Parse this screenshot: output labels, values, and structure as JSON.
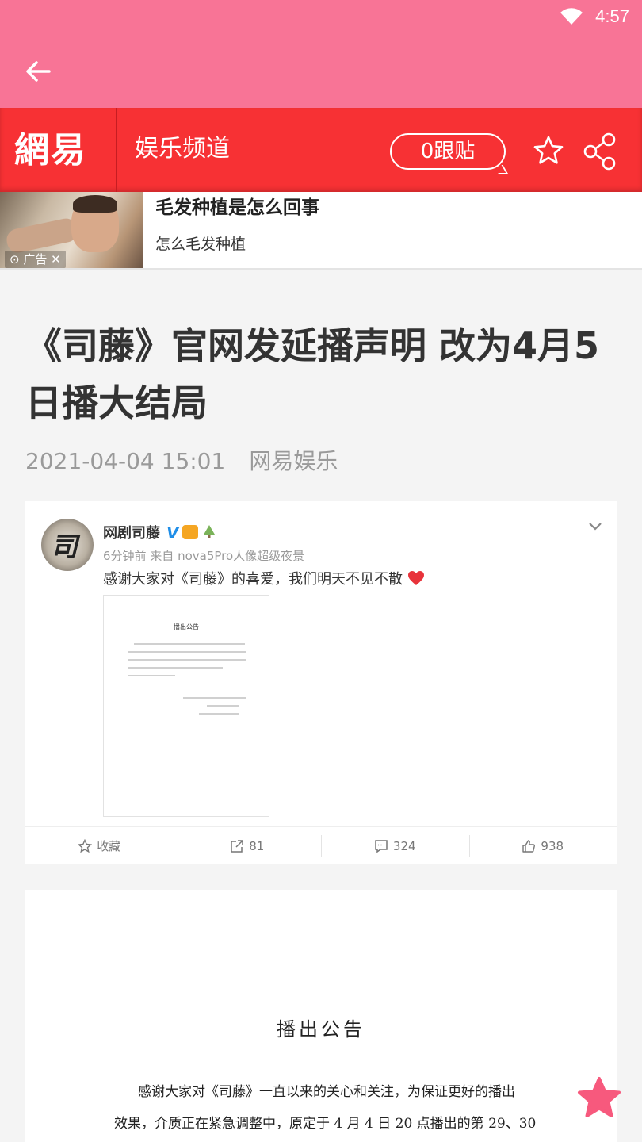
{
  "status_bar": {
    "time": "4:57"
  },
  "nav": {
    "channel": "娱乐频道",
    "comment_count_label": "0跟贴",
    "logo_text": "網易"
  },
  "ad": {
    "title": "毛发种植是怎么回事",
    "subtitle": "怎么毛发种植",
    "badge": "广告"
  },
  "article": {
    "title": "《司藤》官网发延播声明 改为4月5日播大结局",
    "date": "2021-04-04 15:01",
    "source": "网易娱乐"
  },
  "weibo": {
    "account_name": "网剧司藤",
    "avatar_text": "司",
    "time_device": "6分钟前 来自 nova5Pro人像超级夜景",
    "text": "感谢大家对《司藤》的喜爱，我们明天不见不散",
    "image_title": "播出公告",
    "actions": {
      "favorite": "收藏",
      "repost": "81",
      "comment": "324",
      "like": "938"
    }
  },
  "announcement": {
    "title": "播出公告",
    "line1": "感谢大家对《司藤》一直以来的关心和关注，为保证更好的播出",
    "line2": "效果，介质正在紧急调整中，原定于 4 月 4 日 20 点播出的第 29、30"
  },
  "colors": {
    "appbar": "#f87496",
    "netease_red": "#f73134",
    "fab_pink": "#f7597d"
  }
}
